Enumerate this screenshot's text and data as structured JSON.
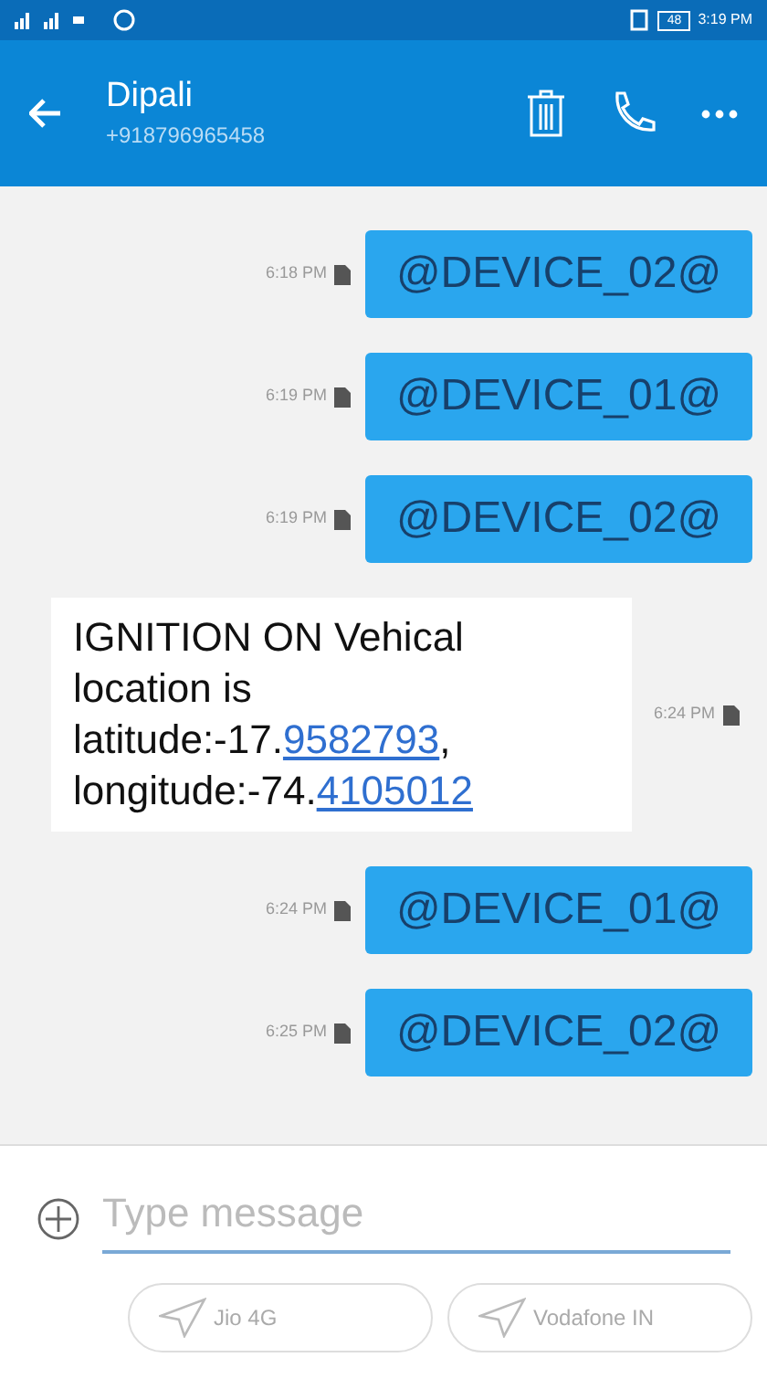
{
  "status_bar": {
    "battery": "48",
    "time": "3:19 PM"
  },
  "header": {
    "name": "Dipali",
    "number": "+918796965458"
  },
  "messages": [
    {
      "kind": "outgoing",
      "time": "6:18 PM",
      "parts": [
        {
          "text": "@DEVICE_02@",
          "link": false
        }
      ]
    },
    {
      "kind": "outgoing",
      "time": "6:19 PM",
      "parts": [
        {
          "text": "@DEVICE_01@",
          "link": false
        }
      ]
    },
    {
      "kind": "outgoing",
      "time": "6:19 PM",
      "parts": [
        {
          "text": "@DEVICE_02@",
          "link": false
        }
      ]
    },
    {
      "kind": "incoming",
      "time": "6:24 PM",
      "parts": [
        {
          "text": "IGNITION ON Vehical location is latitude:-17.",
          "link": false
        },
        {
          "text": "9582793",
          "link": true
        },
        {
          "text": ", longitude:-74.",
          "link": false
        },
        {
          "text": "4105012",
          "link": true
        }
      ]
    },
    {
      "kind": "outgoing",
      "time": "6:24 PM",
      "parts": [
        {
          "text": "@DEVICE_01@",
          "link": false
        }
      ]
    },
    {
      "kind": "outgoing",
      "time": "6:25 PM",
      "parts": [
        {
          "text": "@DEVICE_02@",
          "link": false
        }
      ]
    }
  ],
  "composer": {
    "placeholder": "Type message"
  },
  "sim_buttons": [
    "Jio 4G",
    "Vodafone IN"
  ]
}
